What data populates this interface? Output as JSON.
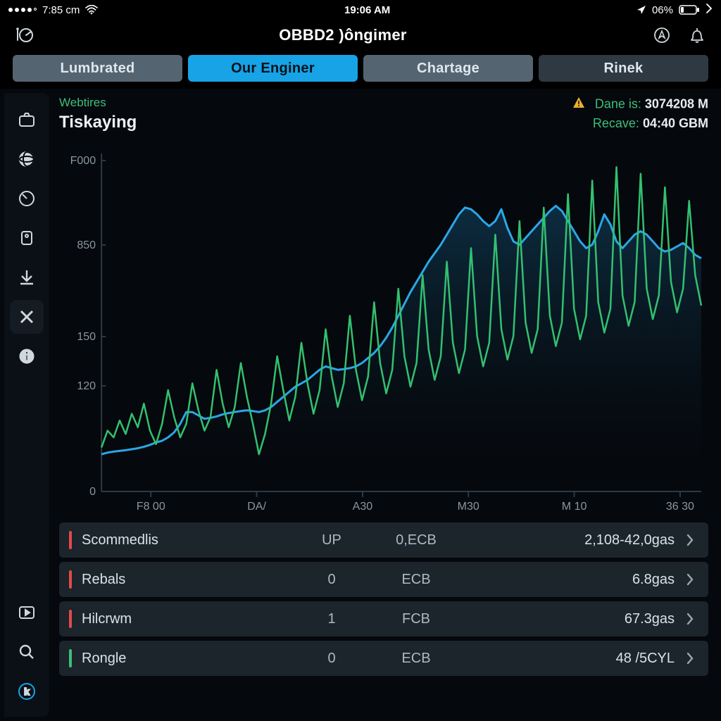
{
  "statusbar": {
    "left_time": "7:85 cm",
    "center_time": "19:06 AM",
    "battery_text": "06%"
  },
  "header": {
    "title": "OBBD2 )ôngimer"
  },
  "tabs": [
    {
      "id": "lumbrated",
      "label": "Lumbrated",
      "active": false,
      "tone": "light"
    },
    {
      "id": "our-enginer",
      "label": "Our Enginer",
      "active": true,
      "tone": "active"
    },
    {
      "id": "chartage",
      "label": "Chartage",
      "active": false,
      "tone": "light"
    },
    {
      "id": "rinek",
      "label": "Rinek",
      "active": false,
      "tone": "dark"
    }
  ],
  "meta": {
    "subtitle": "Webtires",
    "title": "Tiskaying",
    "stat1_label": "Dane is:",
    "stat1_value": "3074208 M",
    "stat2_label": "Recave:",
    "stat2_value": "04:40 GBM"
  },
  "yticks": [
    "F000",
    "850",
    "150",
    "120",
    "0"
  ],
  "xticks": [
    "F8 00",
    "DA/",
    "A30",
    "M30",
    "M 10",
    "36 30"
  ],
  "rows": [
    {
      "color": "red",
      "name": "Scommedlis",
      "c1": "UP",
      "c2": "0,ECB",
      "c3": "2,108-42,0gas"
    },
    {
      "color": "red",
      "name": "Rebals",
      "c1": "0",
      "c2": "ECB",
      "c3": "6.8gas"
    },
    {
      "color": "red",
      "name": "Hilcrwm",
      "c1": "1",
      "c2": "FCB",
      "c3": "67.3gas"
    },
    {
      "color": "green",
      "name": "Rongle",
      "c1": "0",
      "c2": "ECB",
      "c3": "48 /5CYL"
    }
  ],
  "chart_data": {
    "type": "line",
    "title": "Tiskaying",
    "xlabel": "",
    "ylabel": "",
    "ylim": [
      0,
      1000
    ],
    "x_categories": [
      "F8 00",
      "DA/",
      "A30",
      "M30",
      "M 10",
      "36 30"
    ],
    "ytick_labels": [
      "F000",
      "850",
      "150",
      "120",
      "0"
    ],
    "series": [
      {
        "name": "blue",
        "color": "#2aa7e8",
        "values": [
          110,
          115,
          118,
          120,
          122,
          125,
          128,
          132,
          138,
          145,
          150,
          160,
          175,
          200,
          235,
          235,
          225,
          215,
          218,
          222,
          228,
          232,
          235,
          238,
          240,
          238,
          235,
          240,
          250,
          265,
          280,
          295,
          310,
          320,
          330,
          345,
          360,
          370,
          365,
          360,
          362,
          365,
          370,
          380,
          395,
          410,
          430,
          455,
          485,
          520,
          555,
          590,
          620,
          650,
          680,
          705,
          730,
          760,
          790,
          820,
          840,
          835,
          820,
          800,
          785,
          800,
          835,
          780,
          740,
          730,
          750,
          770,
          790,
          810,
          830,
          845,
          830,
          800,
          770,
          740,
          720,
          730,
          770,
          820,
          790,
          740,
          720,
          740,
          760,
          770,
          760,
          740,
          720,
          710,
          715,
          725,
          735,
          720,
          700,
          690
        ]
      },
      {
        "name": "green",
        "color": "#33c06f",
        "values": [
          130,
          180,
          160,
          210,
          170,
          230,
          190,
          260,
          180,
          140,
          200,
          300,
          220,
          160,
          200,
          320,
          240,
          180,
          220,
          360,
          260,
          190,
          250,
          380,
          280,
          200,
          110,
          170,
          260,
          400,
          300,
          210,
          280,
          440,
          320,
          230,
          300,
          480,
          340,
          250,
          320,
          520,
          360,
          270,
          340,
          560,
          380,
          290,
          360,
          600,
          400,
          310,
          380,
          640,
          420,
          330,
          400,
          680,
          440,
          350,
          420,
          720,
          460,
          370,
          440,
          760,
          480,
          390,
          460,
          800,
          500,
          410,
          480,
          840,
          520,
          430,
          500,
          880,
          540,
          450,
          520,
          920,
          560,
          470,
          540,
          960,
          580,
          490,
          560,
          940,
          600,
          510,
          580,
          900,
          620,
          530,
          600,
          860,
          640,
          550
        ]
      }
    ]
  }
}
